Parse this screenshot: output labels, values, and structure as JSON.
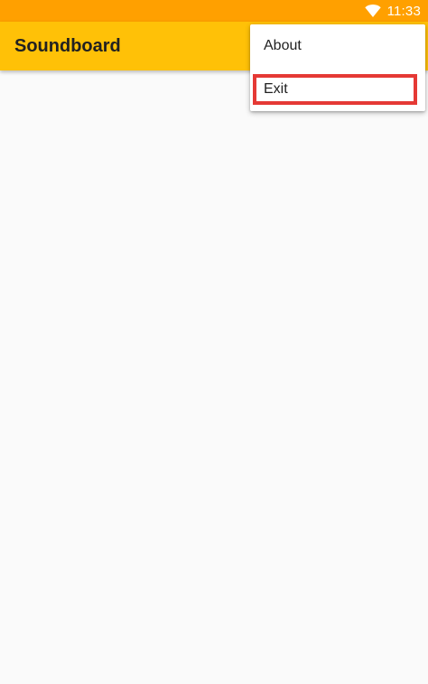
{
  "status_bar": {
    "time": "11:33",
    "background_color": "#ffa000",
    "icons": [
      "wifi-icon"
    ]
  },
  "app_bar": {
    "title": "Soundboard",
    "background_color": "#ffc107"
  },
  "overflow_menu": {
    "items": [
      {
        "label": "About"
      },
      {
        "label": "Exit",
        "highlighted": true
      }
    ],
    "highlight_color": "#e53935"
  },
  "content": {
    "background_color": "#fafafa"
  }
}
